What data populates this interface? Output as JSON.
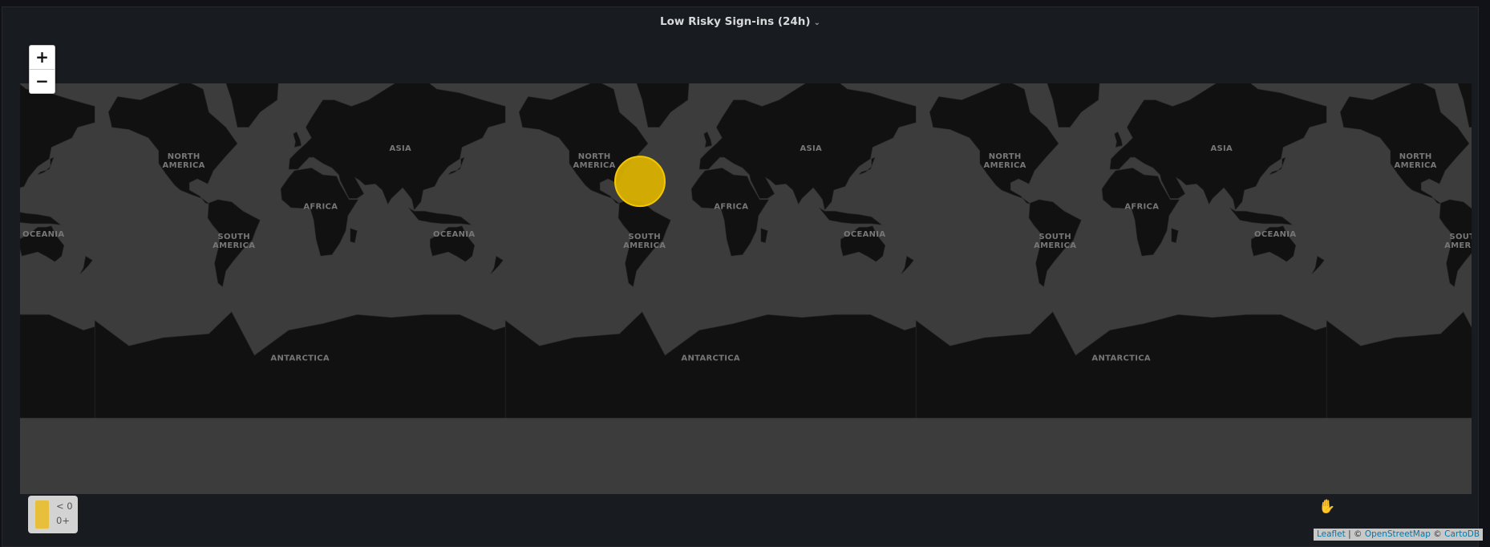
{
  "panel": {
    "title": "Low Risky Sign-ins (24h)"
  },
  "zoom": {
    "in_label": "+",
    "out_label": "−"
  },
  "map": {
    "continent_labels": [
      "NORTH\nAMERICA",
      "ASIA",
      "AFRICA",
      "SOUTH\nAMERICA",
      "OCEANIA",
      "ANTARCTICA"
    ],
    "markers": [
      {
        "lat": 27,
        "lon": -62,
        "color": "#e0b400"
      }
    ],
    "colors": {
      "land": "#111111",
      "water": "#3c3c3c"
    }
  },
  "legend": {
    "swatch_color": "#e8bf3a",
    "items": [
      "< 0",
      "0+"
    ]
  },
  "attribution": {
    "leaflet": "Leaflet",
    "separator": " | © ",
    "osm": "OpenStreetMap",
    "mid": " © ",
    "carto": "CartoDB"
  },
  "icons": {
    "title_dropdown": "chevron-down-icon",
    "cursor": "hand-grab-icon"
  }
}
